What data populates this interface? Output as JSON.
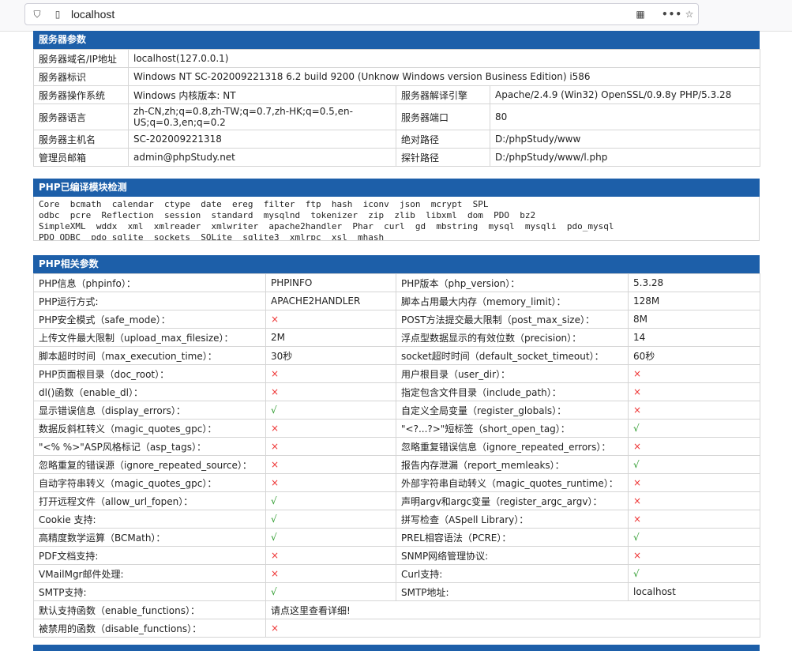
{
  "browser": {
    "url": "localhost"
  },
  "server": {
    "title": "服务器参数",
    "rows": [
      {
        "label": "服务器域名/IP地址",
        "value": "localhost(127.0.0.1)"
      },
      {
        "label": "服务器标识",
        "value": "Windows NT SC-202009221318 6.2 build 9200 (Unknow Windows version Business Edition) i586"
      },
      {
        "label": "服务器操作系统",
        "value": "Windows  内核版本: NT",
        "label2": "服务器解译引擎",
        "value2": "Apache/2.4.9 (Win32) OpenSSL/0.9.8y PHP/5.3.28"
      },
      {
        "label": "服务器语言",
        "value": "zh-CN,zh;q=0.8,zh-TW;q=0.7,zh-HK;q=0.5,en-US;q=0.3,en;q=0.2",
        "label2": "服务器端口",
        "value2": "80"
      },
      {
        "label": "服务器主机名",
        "value": "SC-202009221318",
        "label2": "绝对路径",
        "value2": "D:/phpStudy/www"
      },
      {
        "label": "管理员邮箱",
        "value": "admin@phpStudy.net",
        "label2": "探针路径",
        "value2": "D:/phpStudy/www/l.php"
      }
    ]
  },
  "modules": {
    "title": "PHP已编译模块检测",
    "lines": [
      "Core  bcmath  calendar  ctype  date  ereg  filter  ftp  hash  iconv  json  mcrypt  SPL",
      "odbc  pcre  Reflection  session  standard  mysqlnd  tokenizer  zip  zlib  libxml  dom  PDO  bz2",
      "SimpleXML  wddx  xml  xmlreader  xmlwriter  apache2handler  Phar  curl  gd  mbstring  mysql  mysqli  pdo_mysql",
      "PDO_ODBC  pdo_sqlite  sockets  SQLite  sqlite3  xmlrpc  xsl  mhash"
    ]
  },
  "php": {
    "title": "PHP相关参数",
    "rows": [
      {
        "l1": "PHP信息（phpinfo）：",
        "v1": "PHPINFO",
        "l2": "PHP版本（php_version）：",
        "v2": "5.3.28"
      },
      {
        "l1": "PHP运行方式:",
        "v1": "APACHE2HANDLER",
        "l2": "脚本占用最大内存（memory_limit）：",
        "v2": "128M"
      },
      {
        "l1": "PHP安全模式（safe_mode）：",
        "v1": "×",
        "l2": "POST方法提交最大限制（post_max_size）：",
        "v2": "8M"
      },
      {
        "l1": "上传文件最大限制（upload_max_filesize）：",
        "v1": "2M",
        "l2": "浮点型数据显示的有效位数（precision）：",
        "v2": "14"
      },
      {
        "l1": "脚本超时时间（max_execution_time）：",
        "v1": "30秒",
        "l2": "socket超时时间（default_socket_timeout）：",
        "v2": "60秒"
      },
      {
        "l1": "PHP页面根目录（doc_root）：",
        "v1": "×",
        "l2": "用户根目录（user_dir）：",
        "v2": "×"
      },
      {
        "l1": "dl()函数（enable_dl）：",
        "v1": "×",
        "l2": "指定包含文件目录（include_path）：",
        "v2": "×"
      },
      {
        "l1": "显示错误信息（display_errors）：",
        "v1": "√",
        "l2": "自定义全局变量（register_globals）：",
        "v2": "×"
      },
      {
        "l1": "数据反斜杠转义（magic_quotes_gpc）：",
        "v1": "×",
        "l2": "\"<?...?>\"短标签（short_open_tag）：",
        "v2": "√"
      },
      {
        "l1": "\"<% %>\"ASP风格标记（asp_tags）：",
        "v1": "×",
        "l2": "忽略重复错误信息（ignore_repeated_errors）：",
        "v2": "×"
      },
      {
        "l1": "忽略重复的错误源（ignore_repeated_source）：",
        "v1": "×",
        "l2": "报告内存泄漏（report_memleaks）：",
        "v2": "√"
      },
      {
        "l1": "自动字符串转义（magic_quotes_gpc）：",
        "v1": "×",
        "l2": "外部字符串自动转义（magic_quotes_runtime）：",
        "v2": "×"
      },
      {
        "l1": "打开远程文件（allow_url_fopen）：",
        "v1": "√",
        "l2": "声明argv和argc变量（register_argc_argv）：",
        "v2": "×"
      },
      {
        "l1": "Cookie 支持:",
        "v1": "√",
        "l2": "拼写检查（ASpell Library）：",
        "v2": "×"
      },
      {
        "l1": "高精度数学运算（BCMath）：",
        "v1": "√",
        "l2": "PREL相容语法（PCRE）：",
        "v2": "√"
      },
      {
        "l1": "PDF文档支持:",
        "v1": "×",
        "l2": "SNMP网络管理协议:",
        "v2": "×"
      },
      {
        "l1": "VMailMgr邮件处理:",
        "v1": "×",
        "l2": "Curl支持:",
        "v2": "√"
      },
      {
        "l1": "SMTP支持:",
        "v1": "√",
        "l2": "SMTP地址:",
        "v2": "localhost"
      }
    ],
    "enable_functions_label": "默认支持函数（enable_functions）：",
    "enable_functions_value": "请点这里查看详细!",
    "disable_functions_label": "被禁用的函数（disable_functions）：",
    "disable_functions_value": "×"
  }
}
